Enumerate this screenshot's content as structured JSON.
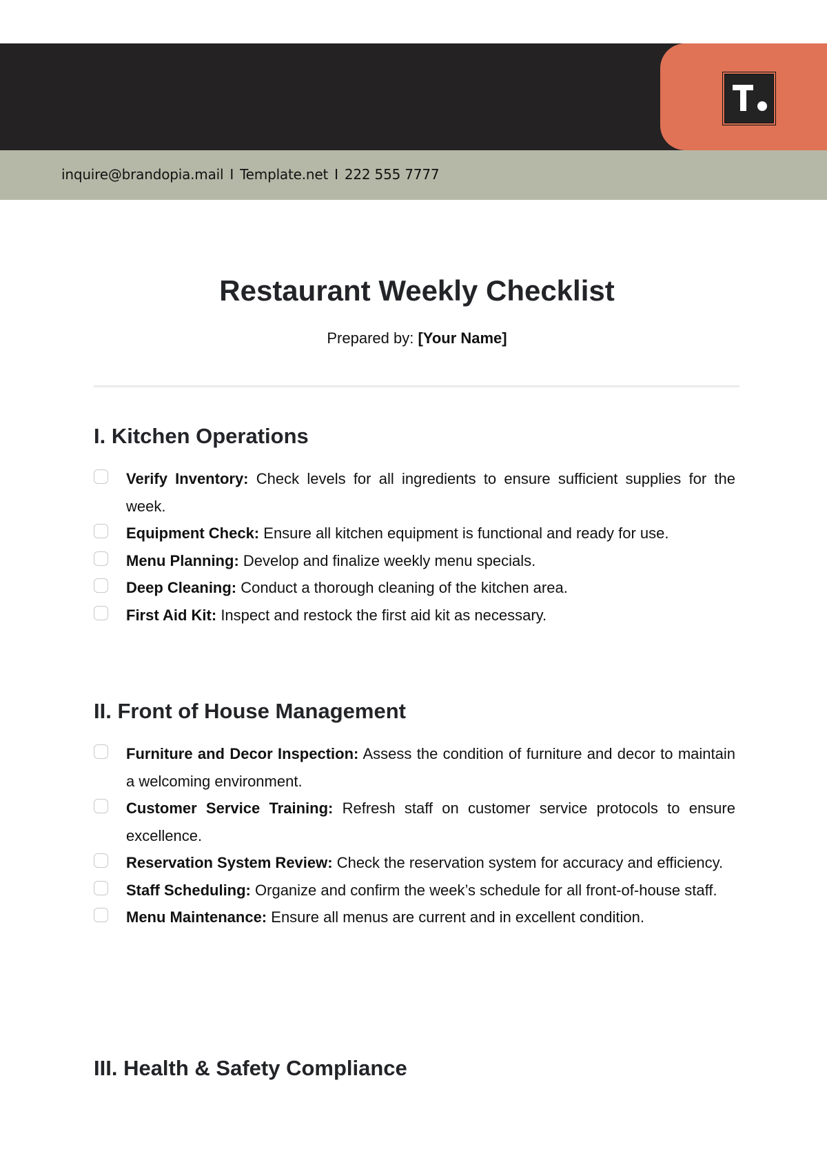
{
  "header": {
    "logo_icon": "template-t-logo-icon",
    "colors": {
      "dark": "#252223",
      "accent": "#e07356",
      "band": "#b6b8a7"
    },
    "contact": {
      "email": "inquire@brandopia.mail",
      "website": "Template.net",
      "phone": "222 555 7777",
      "separator": "I"
    }
  },
  "document": {
    "title": "Restaurant Weekly Checklist",
    "prepared_label": "Prepared by:",
    "prepared_name": "[Your Name]"
  },
  "sections": [
    {
      "heading": "I. Kitchen Operations",
      "items": [
        {
          "label": "Verify Inventory:",
          "text": "Check levels for all ingredients to ensure sufficient supplies for the week.",
          "checked": false
        },
        {
          "label": "Equipment Check:",
          "text": "Ensure all kitchen equipment is functional and ready for use.",
          "checked": false
        },
        {
          "label": "Menu Planning:",
          "text": "Develop and finalize weekly menu specials.",
          "checked": false
        },
        {
          "label": "Deep Cleaning:",
          "text": "Conduct a thorough cleaning of the kitchen area.",
          "checked": false
        },
        {
          "label": "First Aid Kit:",
          "text": "Inspect and restock the first aid kit as necessary.",
          "checked": false
        }
      ]
    },
    {
      "heading": "II. Front of House Management",
      "items": [
        {
          "label": "Furniture and Decor Inspection:",
          "text": "Assess the condition of furniture and decor to maintain a welcoming environment.",
          "checked": false
        },
        {
          "label": "Customer Service Training:",
          "text": "Refresh staff on customer service protocols to ensure excellence.",
          "checked": false
        },
        {
          "label": "Reservation System Review:",
          "text": "Check the reservation system for accuracy and efficiency.",
          "checked": false
        },
        {
          "label": "Staff Scheduling:",
          "text": "Organize and confirm the week’s schedule for all front-of-house staff.",
          "checked": false
        },
        {
          "label": "Menu Maintenance:",
          "text": "Ensure all menus are current and in excellent condition.",
          "checked": false
        }
      ]
    },
    {
      "heading": "III. Health & Safety Compliance",
      "items": []
    }
  ]
}
